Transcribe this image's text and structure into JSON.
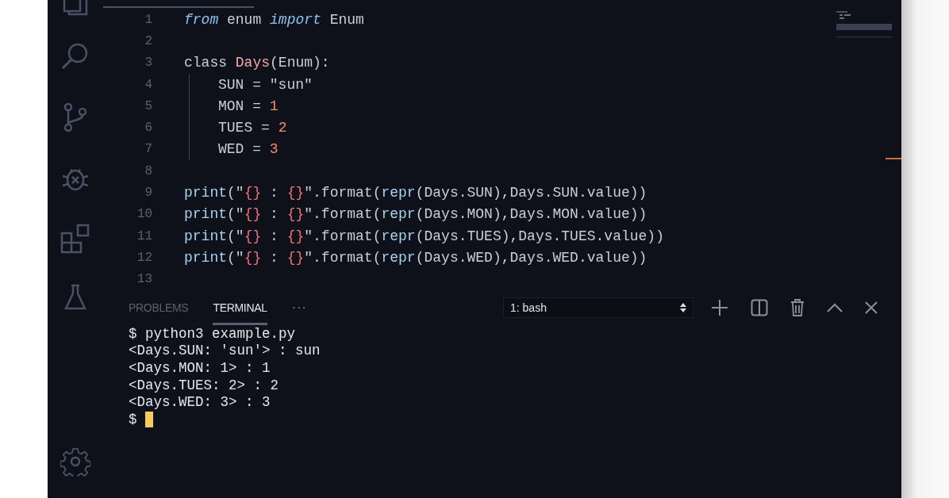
{
  "editor": {
    "lines": [
      {
        "number": "1",
        "tokens": [
          {
            "text": "from",
            "kind": "keyword"
          },
          {
            "text": " enum ",
            "kind": "plain"
          },
          {
            "text": "import",
            "kind": "keyword"
          },
          {
            "text": " Enum",
            "kind": "plain"
          }
        ]
      },
      {
        "number": "2"
      },
      {
        "number": "3",
        "tokens": [
          {
            "text": "class ",
            "kind": "plain"
          },
          {
            "text": "Days",
            "kind": "class"
          },
          {
            "text": "(Enum):",
            "kind": "plain"
          }
        ]
      },
      {
        "number": "4",
        "indent": true,
        "tokens": [
          {
            "text": "SUN = \"sun\"",
            "kind": "plain"
          }
        ]
      },
      {
        "number": "5",
        "indent": true,
        "tokens": [
          {
            "text": "MON = ",
            "kind": "plain"
          },
          {
            "text": "1",
            "kind": "number"
          }
        ]
      },
      {
        "number": "6",
        "indent": true,
        "tokens": [
          {
            "text": "TUES = ",
            "kind": "plain"
          },
          {
            "text": "2",
            "kind": "number"
          }
        ]
      },
      {
        "number": "7",
        "indent": true,
        "tokens": [
          {
            "text": "WED = ",
            "kind": "plain"
          },
          {
            "text": "3",
            "kind": "number"
          }
        ]
      },
      {
        "number": "8"
      },
      {
        "number": "9",
        "tokens": [
          {
            "text": "print",
            "kind": "func"
          },
          {
            "text": "(\"",
            "kind": "plain"
          },
          {
            "text": "{}",
            "kind": "brace"
          },
          {
            "text": " : ",
            "kind": "plain"
          },
          {
            "text": "{}",
            "kind": "brace"
          },
          {
            "text": "\".format(",
            "kind": "plain"
          },
          {
            "text": "repr",
            "kind": "func"
          },
          {
            "text": "(Days.SUN),Days.SUN.value))",
            "kind": "plain"
          }
        ]
      },
      {
        "number": "10",
        "tokens": [
          {
            "text": "print",
            "kind": "func"
          },
          {
            "text": "(\"",
            "kind": "plain"
          },
          {
            "text": "{}",
            "kind": "brace"
          },
          {
            "text": " : ",
            "kind": "plain"
          },
          {
            "text": "{}",
            "kind": "brace"
          },
          {
            "text": "\".format(",
            "kind": "plain"
          },
          {
            "text": "repr",
            "kind": "func"
          },
          {
            "text": "(Days.MON),Days.MON.value))",
            "kind": "plain"
          }
        ]
      },
      {
        "number": "11",
        "tokens": [
          {
            "text": "print",
            "kind": "func"
          },
          {
            "text": "(\"",
            "kind": "plain"
          },
          {
            "text": "{}",
            "kind": "brace"
          },
          {
            "text": " : ",
            "kind": "plain"
          },
          {
            "text": "{}",
            "kind": "brace"
          },
          {
            "text": "\".format(",
            "kind": "plain"
          },
          {
            "text": "repr",
            "kind": "func"
          },
          {
            "text": "(Days.TUES),Days.TUES.value))",
            "kind": "plain"
          }
        ]
      },
      {
        "number": "12",
        "tokens": [
          {
            "text": "print",
            "kind": "func"
          },
          {
            "text": "(\"",
            "kind": "plain"
          },
          {
            "text": "{}",
            "kind": "brace"
          },
          {
            "text": " : ",
            "kind": "plain"
          },
          {
            "text": "{}",
            "kind": "brace"
          },
          {
            "text": "\".format(",
            "kind": "plain"
          },
          {
            "text": "repr",
            "kind": "func"
          },
          {
            "text": "(Days.WED),Days.WED.value))",
            "kind": "plain"
          }
        ]
      },
      {
        "number": "13"
      }
    ]
  },
  "panel": {
    "tabs": [
      {
        "label": "PROBLEMS",
        "selected": false
      },
      {
        "label": "TERMINAL",
        "selected": true
      }
    ],
    "more": "···",
    "terminal_select": {
      "value": "1: bash"
    },
    "terminal": {
      "lines": [
        {
          "text": "$ python3 example.py"
        },
        {
          "text": "<Days.SUN: 'sun'> : sun"
        },
        {
          "text": "<Days.MON: 1> : 1"
        },
        {
          "text": "<Days.TUES: 2> : 2"
        },
        {
          "text": "<Days.WED: 3> : 3"
        },
        {
          "text": "$",
          "cursor": true
        }
      ]
    }
  }
}
